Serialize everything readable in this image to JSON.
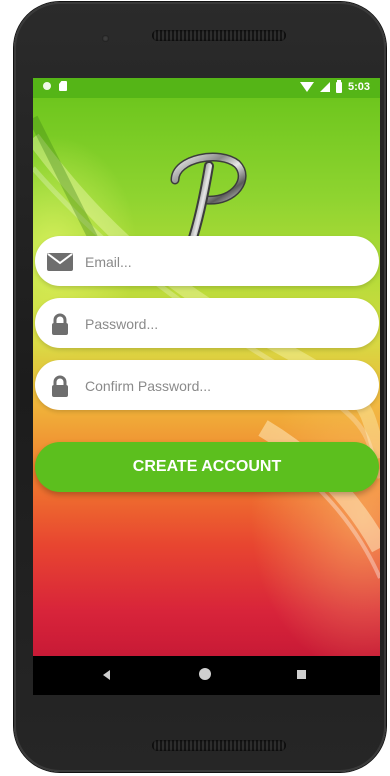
{
  "status_bar": {
    "time": "5:03"
  },
  "form": {
    "email_placeholder": "Email...",
    "password_placeholder": "Password...",
    "confirm_password_placeholder": "Confirm Password...",
    "email_value": "",
    "password_value": "",
    "confirm_password_value": ""
  },
  "actions": {
    "create_account_label": "CREATE ACCOUNT"
  },
  "icons": {
    "email": "envelope-icon",
    "password": "lock-icon",
    "confirm_password": "lock-icon",
    "nav_back": "back-triangle-icon",
    "nav_home": "home-circle-icon",
    "nav_recents": "recents-square-icon"
  },
  "colors": {
    "accent": "#5cbf1e",
    "status_bar": "#55b517",
    "field_background": "#ffffff",
    "nav_bar": "#000000"
  }
}
